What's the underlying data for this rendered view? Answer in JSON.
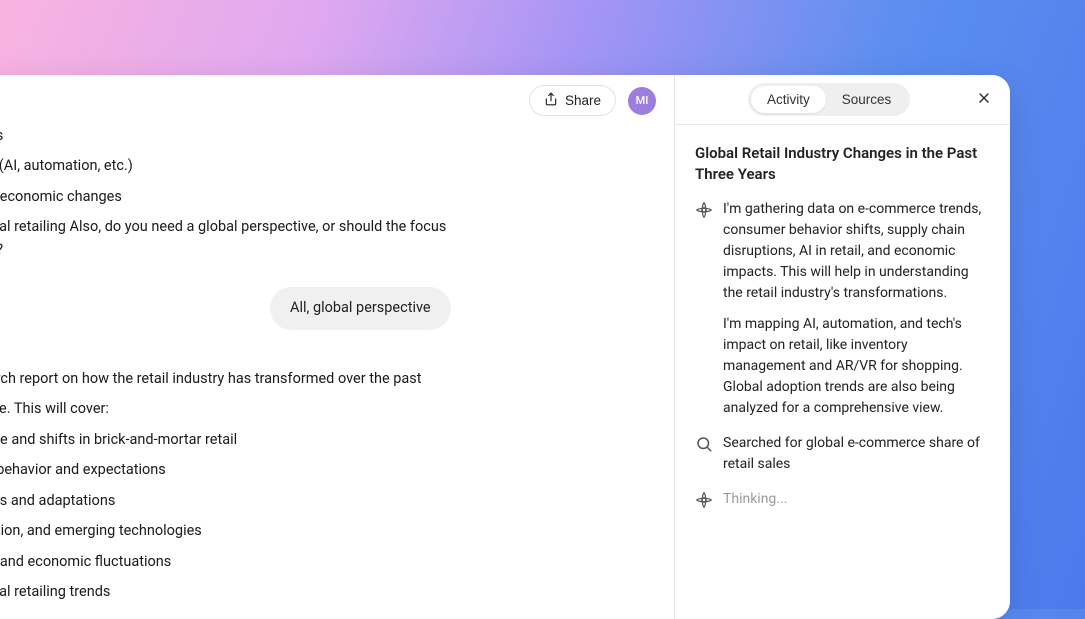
{
  "topbar": {
    "share_label": "Share",
    "avatar_initials": "MI"
  },
  "conversation": {
    "lines_top": [
      "ges",
      "es (AI, automation, etc.)",
      "nd economic changes"
    ],
    "question_wrap": "hical retailing Also, do you need a global perspective, or should the focus on?",
    "pill": "All, global perspective",
    "lines_mid": [
      "earch report on how the retail industry has transformed over the past",
      "cale. This will cover:"
    ],
    "bullets": [
      "erce and shifts in brick-and-mortar retail",
      "er behavior and expectations",
      "ions and adaptations",
      "nation, and emerging technologies",
      "on and economic fluctuations",
      "hical retailing trends"
    ]
  },
  "side": {
    "tabs": {
      "activity": "Activity",
      "sources": "Sources"
    },
    "title": "Global Retail Industry Changes in the Past Three Years",
    "activity1_p1": "I'm gathering data on e-commerce trends, consumer behavior shifts, supply chain disruptions, AI in retail, and economic impacts. This will help in understanding the retail industry's transformations.",
    "activity1_p2": "I'm mapping AI, automation, and tech's impact on retail, like inventory management and AR/VR for shopping. Global adoption trends are also being analyzed for a comprehensive view.",
    "search_text": "Searched for global e-commerce share of retail sales",
    "thinking": "Thinking..."
  }
}
